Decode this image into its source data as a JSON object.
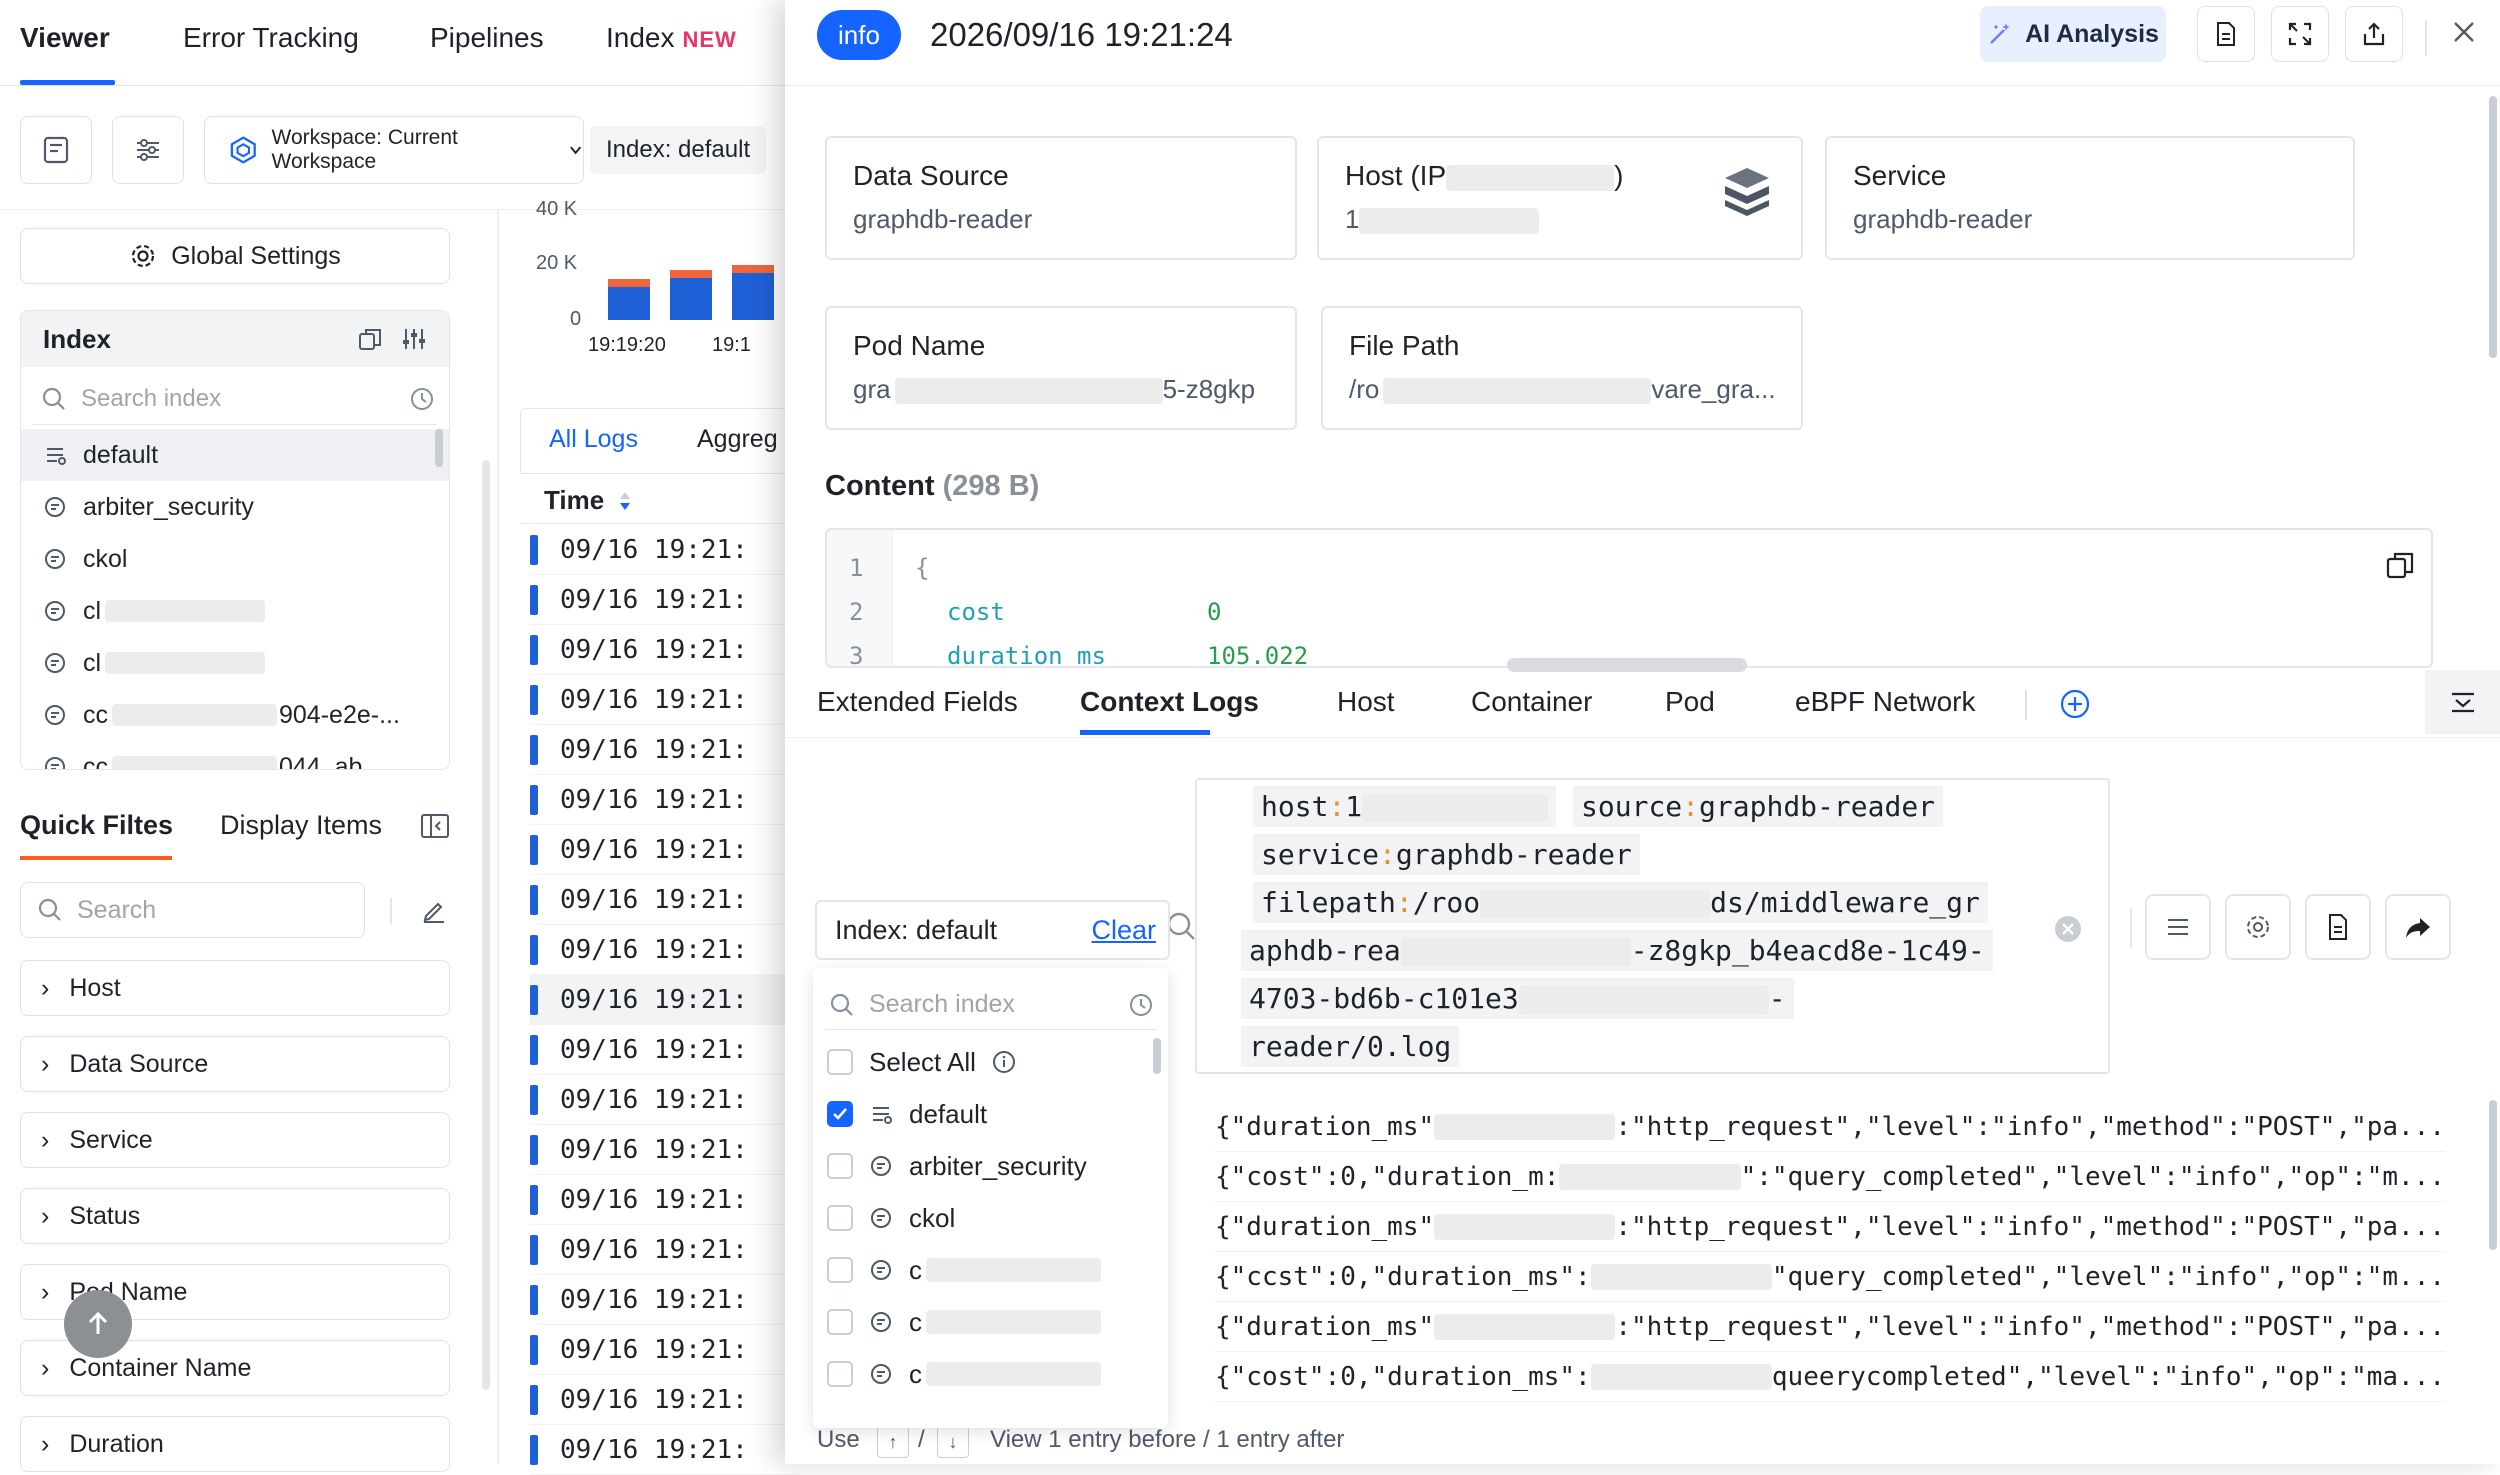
{
  "nav": {
    "tabs": [
      "Viewer",
      "Error Tracking",
      "Pipelines",
      "Index"
    ],
    "new_badge": "NEW"
  },
  "toolbar": {
    "workspace_label": "Workspace: Current Workspace",
    "index_label": "Index:  default"
  },
  "sidebar": {
    "global_settings": "Global Settings",
    "index_title": "Index",
    "index_search_placeholder": "Search index",
    "index_items": [
      "default",
      "arbiter_security",
      "ckol",
      "cl",
      "cl",
      "cc",
      "cc"
    ],
    "index_item_suffixes": [
      "904-e2e-...",
      "044_ab"
    ],
    "quick_filters_tab": "Quick Filtes",
    "display_items_tab": "Display Items",
    "filter_search_placeholder": "Search",
    "filters": [
      "Host",
      "Data Source",
      "Service",
      "Status",
      "Pod Name",
      "Container Name",
      "Duration"
    ]
  },
  "chart": {
    "y_ticks": [
      "40 K",
      "20 K",
      "0"
    ],
    "x_ticks": [
      "19:19:20",
      "19:1"
    ],
    "bar_fractions": [
      0.34,
      0.42,
      0.46
    ]
  },
  "logs": {
    "tabs": [
      "All Logs",
      "Aggreg"
    ],
    "time_header": "Time",
    "rows": [
      "09/16 19:21:",
      "09/16 19:21:",
      "09/16 19:21:",
      "09/16 19:21:",
      "09/16 19:21:",
      "09/16 19:21:",
      "09/16 19:21:",
      "09/16 19:21:",
      "09/16 19:21:",
      "09/16 19:21:",
      "09/16 19:21:",
      "09/16 19:21:",
      "09/16 19:21:",
      "09/16 19:21:",
      "09/16 19:21:",
      "09/16 19:21:",
      "09/16 19:21:",
      "09/16 19:21:",
      "09/16 19:21:"
    ]
  },
  "drawer": {
    "level": "info",
    "timestamp": "2026/09/16 19:21:24",
    "ai_analysis": "AI Analysis",
    "cards": {
      "data_source": {
        "title": "Data Source",
        "value": "graphdb-reader"
      },
      "host": {
        "title_prefix": "Host (IP",
        "title_suffix": ")",
        "value_prefix": "1"
      },
      "service": {
        "title": "Service",
        "value": "graphdb-reader"
      },
      "pod_name": {
        "title": "Pod Name",
        "value_prefix": "gra",
        "value_suffix": "5-z8gkp"
      },
      "file_path": {
        "title": "File Path",
        "value_prefix": "/ro",
        "value_suffix": "vare_gra..."
      }
    },
    "content_title": "Content",
    "content_size": "(298 B)",
    "code": {
      "line_numbers": [
        "1",
        "2",
        "3"
      ],
      "open_brace": "{",
      "lines": [
        {
          "key": "cost",
          "value": "0"
        },
        {
          "key": "duration_ms",
          "value": "105.022"
        }
      ]
    },
    "tabs": [
      "Extended Fields",
      "Context Logs",
      "Host",
      "Container",
      "Pod",
      "eBPF Network"
    ],
    "context": {
      "index_label": "Index: default",
      "clear": "Clear",
      "query": {
        "host_key": "host",
        "host_prefix": "1",
        "source_key": "source",
        "source_value": "graphdb-reader",
        "service_key": "service",
        "service_value": "graphdb-reader",
        "filepath_key": "filepath",
        "filepath_prefix": "/roo",
        "filepath_mid": "ds/middleware_gr",
        "line4_a": "aphdb-rea",
        "line4_b": "-z8gkp_b4eacd8e-1c49-",
        "line5_a": "4703-bd6b-c101e3",
        "line5_b": "-",
        "line6": "reader/0.log"
      },
      "dropdown": {
        "search_placeholder": "Search index",
        "select_all": "Select All",
        "items": [
          "default",
          "arbiter_security",
          "ckol",
          "c",
          "c",
          "c"
        ]
      },
      "rows": [
        {
          "prefix": "{\"duration_ms\"",
          "suffix": ":\"http_request\",\"level\":\"info\",\"method\":\"POST\",\"pa..."
        },
        {
          "prefix": "{\"cost\":0,\"duration_m:",
          "suffix": "\":\"query_completed\",\"level\":\"info\",\"op\":\"m..."
        },
        {
          "prefix": "{\"duration_ms\"",
          "suffix": ":\"http_request\",\"level\":\"info\",\"method\":\"POST\",\"pa..."
        },
        {
          "prefix": "{\"ccst\":0,\"duration_ms\":",
          "suffix": "\"query_completed\",\"level\":\"info\",\"op\":\"m..."
        },
        {
          "prefix": "{\"duration_ms\"",
          "suffix": ":\"http_request\",\"level\":\"info\",\"method\":\"POST\",\"pa..."
        },
        {
          "prefix": "{\"cost\":0,\"duration_ms\":",
          "suffix": "queerycompleted\",\"level\":\"info\",\"op\":\"ma..."
        }
      ],
      "footer_use": "Use",
      "footer_sep": "/",
      "footer_hint": "View 1 entry before / 1 entry after"
    }
  }
}
